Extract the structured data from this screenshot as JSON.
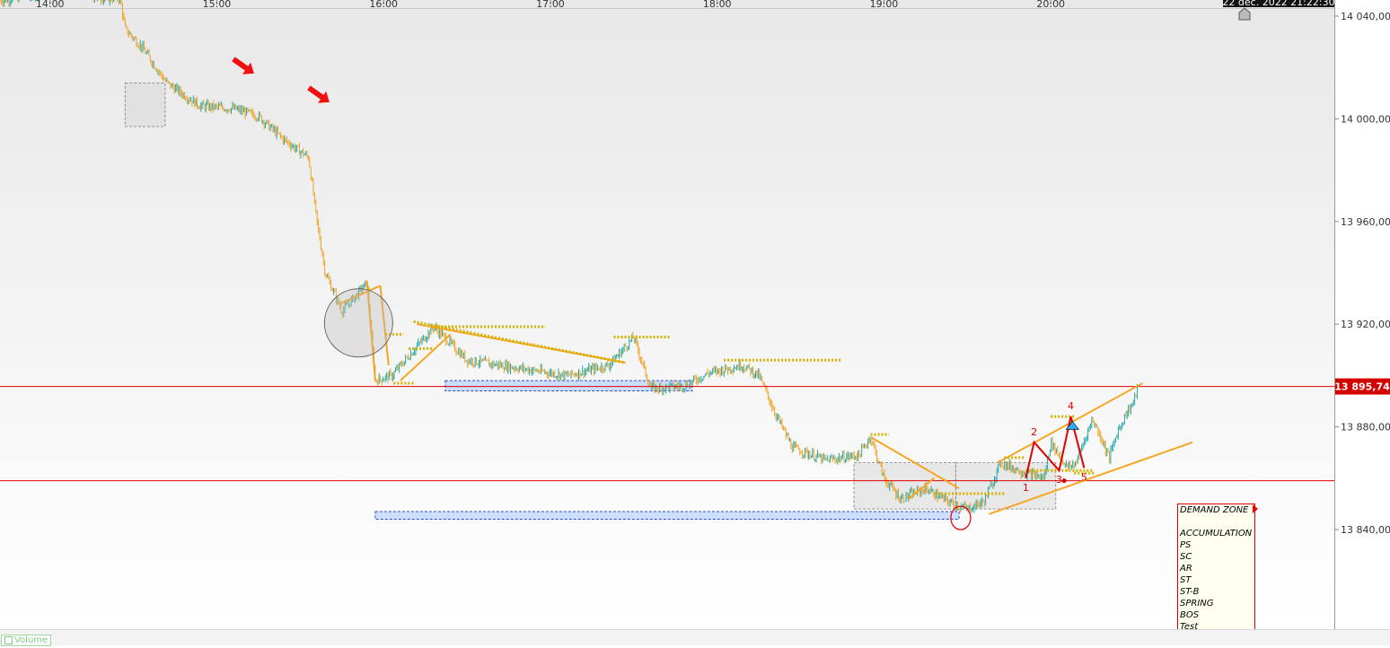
{
  "chart_data": {
    "type": "candlestick",
    "title": "",
    "xlabel": "",
    "ylabel": "",
    "x_ticks": [
      "14:00",
      "15:00",
      "16:00",
      "17:00",
      "18:00",
      "19:00",
      "20:00"
    ],
    "y_ticks": [
      "14 040,00",
      "14 000,00",
      "13 960,00",
      "13 920,00",
      "13 880,00",
      "13 840,00"
    ],
    "y_tick_values": [
      14040,
      14000,
      13960,
      13920,
      13880,
      13840
    ],
    "ylim": [
      13803,
      14045
    ],
    "x_range_hours": [
      13.7,
      21.7
    ],
    "grid": false,
    "timestamp_label": "22 déc. 2022 21:22:30",
    "last_price_label": "13 895,74",
    "last_price_value": 13895.74,
    "support_line_value": 13859,
    "price_path": [
      [
        13.7,
        14046
      ],
      [
        14.05,
        14050
      ],
      [
        14.3,
        14047
      ],
      [
        14.42,
        14047
      ],
      [
        14.45,
        14035
      ],
      [
        14.55,
        14028
      ],
      [
        14.7,
        14014
      ],
      [
        14.9,
        14005
      ],
      [
        15.1,
        14004
      ],
      [
        15.25,
        14001
      ],
      [
        15.4,
        13992
      ],
      [
        15.55,
        13985
      ],
      [
        15.6,
        13960
      ],
      [
        15.65,
        13940
      ],
      [
        15.75,
        13925
      ],
      [
        15.9,
        13936
      ],
      [
        15.95,
        13898
      ],
      [
        16.05,
        13900
      ],
      [
        16.3,
        13919
      ],
      [
        16.5,
        13906
      ],
      [
        16.8,
        13903
      ],
      [
        17.1,
        13900
      ],
      [
        17.35,
        13904
      ],
      [
        17.5,
        13915
      ],
      [
        17.6,
        13895
      ],
      [
        17.8,
        13896
      ],
      [
        17.95,
        13901
      ],
      [
        18.15,
        13904
      ],
      [
        18.25,
        13900
      ],
      [
        18.35,
        13885
      ],
      [
        18.45,
        13872
      ],
      [
        18.65,
        13867
      ],
      [
        18.85,
        13869
      ],
      [
        18.92,
        13876
      ],
      [
        19.0,
        13860
      ],
      [
        19.1,
        13852
      ],
      [
        19.25,
        13856
      ],
      [
        19.35,
        13852
      ],
      [
        19.45,
        13849
      ],
      [
        19.5,
        13848
      ],
      [
        19.6,
        13851
      ],
      [
        19.7,
        13866
      ],
      [
        19.85,
        13862
      ],
      [
        19.96,
        13860
      ],
      [
        20.0,
        13874
      ],
      [
        20.1,
        13864
      ],
      [
        20.15,
        13866
      ],
      [
        20.25,
        13883
      ],
      [
        20.3,
        13876
      ],
      [
        20.35,
        13868
      ],
      [
        20.4,
        13878
      ],
      [
        20.45,
        13885
      ],
      [
        20.5,
        13890
      ],
      [
        20.52,
        13896
      ]
    ],
    "annotations": {
      "wave_labels": [
        "1",
        "2",
        "3",
        "4",
        "5"
      ],
      "wave_points": [
        [
          19.85,
          13860
        ],
        [
          19.9,
          13874
        ],
        [
          20.05,
          13863
        ],
        [
          20.12,
          13884
        ],
        [
          20.2,
          13864
        ]
      ],
      "blue_zones": [
        {
          "x0": 16.37,
          "x1": 17.85,
          "y0": 13894,
          "y1": 13898
        },
        {
          "x0": 15.95,
          "x1": 19.45,
          "y0": 13844,
          "y1": 13847
        }
      ],
      "gray_boxes": [
        {
          "x0": 14.45,
          "x1": 14.69,
          "y0": 13997,
          "y1": 14014
        },
        {
          "x0": 18.82,
          "x1": 19.43,
          "y0": 13848,
          "y1": 13866
        },
        {
          "x0": 19.43,
          "x1": 20.03,
          "y0": 13848,
          "y1": 13866
        }
      ],
      "legend_items": [
        "DEMAND ZONE",
        "",
        "ACCUMULATION",
        "PS",
        "SC",
        "AR",
        "ST",
        "ST-B",
        "SPRING",
        "BOS",
        "Test"
      ]
    },
    "colors": {
      "up_candle": "#22a8a8",
      "down_candle": "#f0a020",
      "red_line": "#e00000",
      "orange_line": "#f5a623",
      "dotted_level": "#d4b000",
      "blue_zone": "#c8dcff",
      "axis_bg": "#ffffff"
    }
  },
  "bottom_bar": {
    "volume_label": "Volume"
  }
}
